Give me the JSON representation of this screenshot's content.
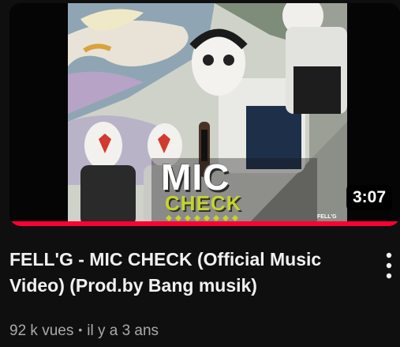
{
  "video": {
    "title": "FELL'G - MIC CHECK (Official Music Video) (Prod.by Bang musik)",
    "duration": "3:07",
    "views": "92 k vues",
    "separator": "•",
    "published": "il y a 3 ans",
    "watch_progress": 1.0
  },
  "thumbnail": {
    "logo_line1": "MIC",
    "logo_line2": "CHECK",
    "logo_artist": "FELL'G"
  },
  "icons": {
    "menu": "more-vert-icon"
  },
  "colors": {
    "background": "#0f0f0f",
    "title": "#f1f1f1",
    "meta": "#aaaaaa",
    "progress": "#ff0033",
    "logo_check": "#c5d52a"
  }
}
